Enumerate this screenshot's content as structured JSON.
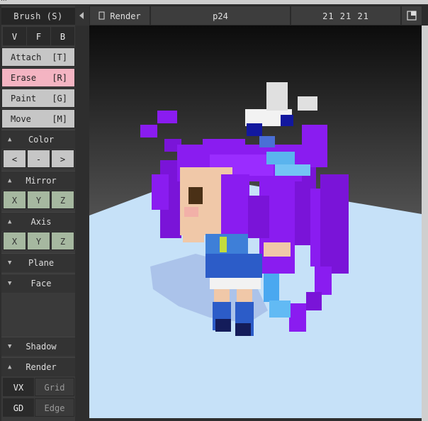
{
  "sidebar": {
    "title": "Brush (S)",
    "modes": [
      "V",
      "F",
      "B"
    ],
    "tools": [
      {
        "label": "Attach",
        "key": "[T]",
        "active": false
      },
      {
        "label": "Erase",
        "key": "[R]",
        "active": true
      },
      {
        "label": "Paint",
        "key": "[G]",
        "active": false
      },
      {
        "label": "Move",
        "key": "[M]",
        "active": false
      }
    ],
    "color": {
      "label": "Color",
      "buttons": [
        "<",
        "-",
        ">"
      ]
    },
    "mirror": {
      "label": "Mirror",
      "axes": [
        "X",
        "Y",
        "Z"
      ]
    },
    "axis": {
      "label": "Axis",
      "axes": [
        "X",
        "Y",
        "Z"
      ]
    },
    "plane": {
      "label": "Plane"
    },
    "face": {
      "label": "Face"
    },
    "shadow": {
      "label": "Shadow"
    },
    "render": {
      "label": "Render"
    },
    "bottom_row1": [
      "VX",
      "Grid"
    ],
    "bottom_row2": [
      "GD",
      "Edge"
    ]
  },
  "topbar": {
    "render_label": "Render",
    "model_name": "p24",
    "dimensions": "21 21 21"
  },
  "colors": {
    "erase_active": "#f4b4c2",
    "axis_green": "#a6b8a0",
    "floor": "#c6e1f8",
    "hair_purple": "#8a1cf0"
  },
  "icons": [
    "collapse-arrow-icon",
    "render-toggle-icon",
    "maximize-icon",
    "expanded-triangle-icon",
    "collapsed-triangle-icon"
  ]
}
